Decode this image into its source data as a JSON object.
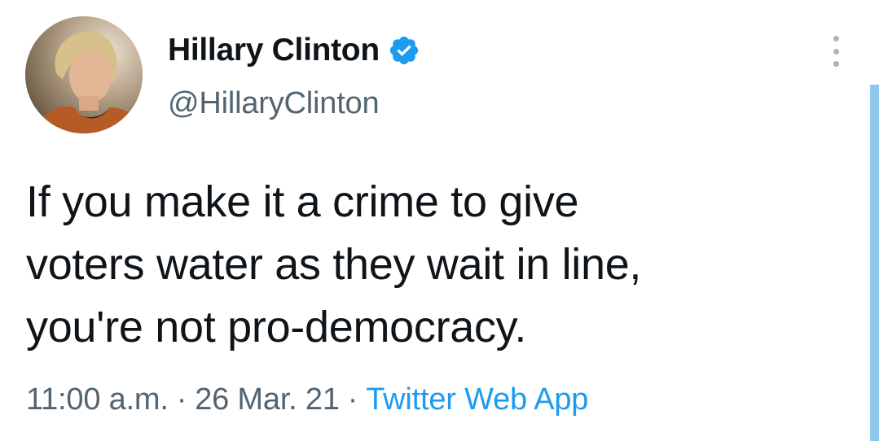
{
  "tweet": {
    "author": {
      "display_name": "Hillary Clinton",
      "handle": "@HillaryClinton",
      "verified": true,
      "verified_icon": "verified-badge-icon",
      "avatar_icon": "profile-photo"
    },
    "text_lines": [
      "If you make it a crime to give",
      "voters water as they wait in line,",
      "you're not pro-democracy."
    ],
    "meta": {
      "time": "11:00 a.m.",
      "separator": "·",
      "date": "26 Mar. 21",
      "source": "Twitter Web App"
    },
    "more_icon": "more-options-icon"
  },
  "colors": {
    "text": "#0f1419",
    "secondary": "#536471",
    "accent": "#1d9bf0",
    "scrollbar": "#8ec8ec"
  }
}
